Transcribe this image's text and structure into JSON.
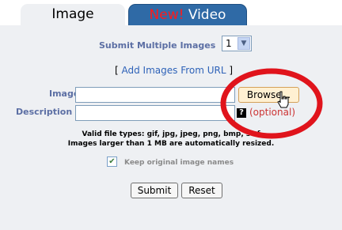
{
  "tabs": {
    "image_label": "Image",
    "video_new": "New!",
    "video_label": " Video"
  },
  "form": {
    "submit_multiple_label": "Submit Multiple Images",
    "submit_multiple_value": "1",
    "add_from_url_open": "[ ",
    "add_from_url_link": "Add Images From URL",
    "add_from_url_close": " ]",
    "image_label": "Image",
    "description_label": "Description",
    "image_value": "",
    "description_value": "",
    "browse_label": "Browse...",
    "help_icon_text": "?",
    "optional_text": "(optional)",
    "valid_types_line": "Valid file types: gif, jpg, jpeg, png, bmp, swf",
    "resize_line": "Images larger than 1 MB are automatically resized.",
    "keep_names_label": "Keep original image names",
    "keep_names_checked": true,
    "submit_label": "Submit",
    "reset_label": "Reset"
  },
  "colors": {
    "panel_bg": "#eef0f3",
    "tab_active_bg": "#eef0f3",
    "tab_inactive_bg": "#2f6aa6",
    "new_badge": "#ff1a1a",
    "label_blue": "#5c6fa4",
    "optional_red": "#cc3333",
    "highlight_circle": "#e0141c"
  },
  "icons": {
    "select_arrow": "chevron-down-icon",
    "help": "help-icon",
    "pointer": "hand-cursor-icon",
    "checkbox": "checkmark-icon"
  }
}
